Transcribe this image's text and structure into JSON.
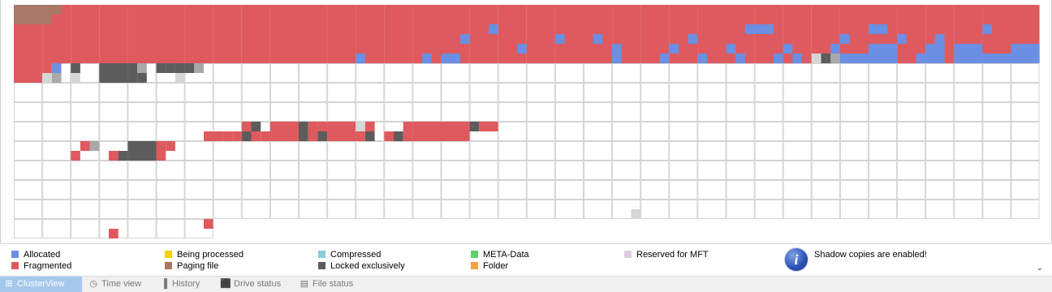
{
  "legend": {
    "items": [
      {
        "label": "Allocated",
        "color": "#6b8fe2"
      },
      {
        "label": "Fragmented",
        "color": "#de5a5e"
      },
      {
        "label": "Being processed",
        "color": "#f5d000"
      },
      {
        "label": "Paging file",
        "color": "#a87766"
      },
      {
        "label": "Compressed",
        "color": "#8acbde"
      },
      {
        "label": "Locked exclusively",
        "color": "#5c5c5c"
      },
      {
        "label": "META-Data",
        "color": "#5ed36a"
      },
      {
        "label": "Folder",
        "color": "#f6a24a"
      },
      {
        "label": "Reserved for MFT",
        "color": "#dccbe0"
      }
    ],
    "info_text": "Shadow copies are enabled!",
    "info_icon": "info-icon"
  },
  "tabs": [
    {
      "label": "ClusterView",
      "icon": "cluster-grid-icon",
      "active": true
    },
    {
      "label": "Time view",
      "icon": "clock-icon",
      "active": false
    },
    {
      "label": "History",
      "icon": "bar-chart-icon",
      "active": false
    },
    {
      "label": "Drive status",
      "icon": "drive-icon",
      "active": false
    },
    {
      "label": "File status",
      "icon": "file-icon",
      "active": false
    }
  ],
  "cluster_map": {
    "colors": {
      "allocated": "#6b8fe2",
      "fragmented": "#de5a5e",
      "paging": "#a87766",
      "locked": "#5c5c5c",
      "light_gray": "#a9a9a9",
      "reserved": "#d6d6d6",
      "free_line": "#d4d4d4"
    }
  }
}
